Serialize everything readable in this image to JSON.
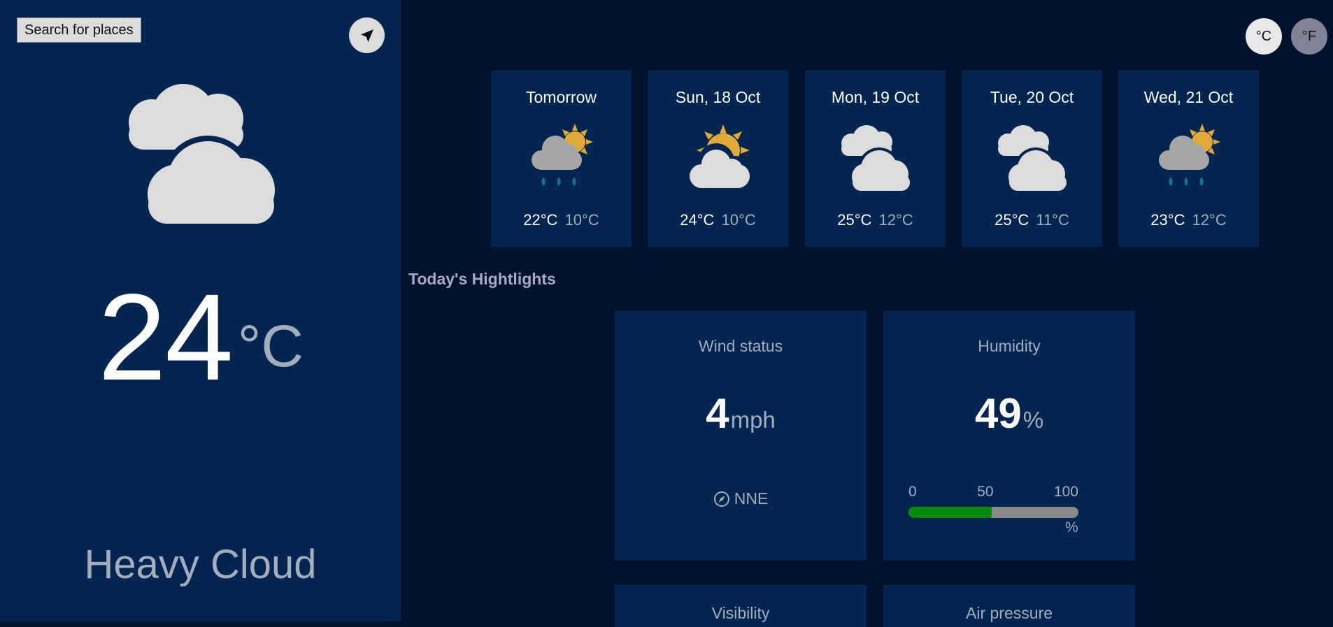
{
  "search": {
    "label": "Search for places"
  },
  "sidebar": {
    "current_temp": "24",
    "temp_unit": "°C",
    "condition": "Heavy Cloud",
    "icon": "heavy-cloud-icon"
  },
  "units": {
    "celsius": "°C",
    "fahrenheit": "°F"
  },
  "forecast": [
    {
      "day": "Tomorrow",
      "max": "22°C",
      "min": "10°C",
      "icon": "light-rain-icon"
    },
    {
      "day": "Sun, 18 Oct",
      "max": "24°C",
      "min": "10°C",
      "icon": "light-cloud-icon"
    },
    {
      "day": "Mon, 19 Oct",
      "max": "25°C",
      "min": "12°C",
      "icon": "heavy-cloud-icon"
    },
    {
      "day": "Tue, 20 Oct",
      "max": "25°C",
      "min": "11°C",
      "icon": "heavy-cloud-icon"
    },
    {
      "day": "Wed, 21 Oct",
      "max": "23°C",
      "min": "12°C",
      "icon": "light-rain-icon"
    }
  ],
  "highlights": {
    "title": "Today's Hightlights",
    "wind": {
      "label": "Wind status",
      "value": "4",
      "unit": "mph",
      "direction": "NNE"
    },
    "humidity": {
      "label": "Humidity",
      "value": "49",
      "unit": "%",
      "scale": [
        "0",
        "50",
        "100"
      ],
      "scale_unit": "%",
      "percent": 49
    },
    "visibility": {
      "label": "Visibility"
    },
    "air_pressure": {
      "label": "Air pressure"
    }
  },
  "colors": {
    "background": "#01122f",
    "panel": "#03254f",
    "muted_text": "#a4adbd",
    "sun": "#e0a93a",
    "cloud": "#dcdcdc",
    "rain": "#17748a",
    "humidity_fill": "#078b0a"
  }
}
